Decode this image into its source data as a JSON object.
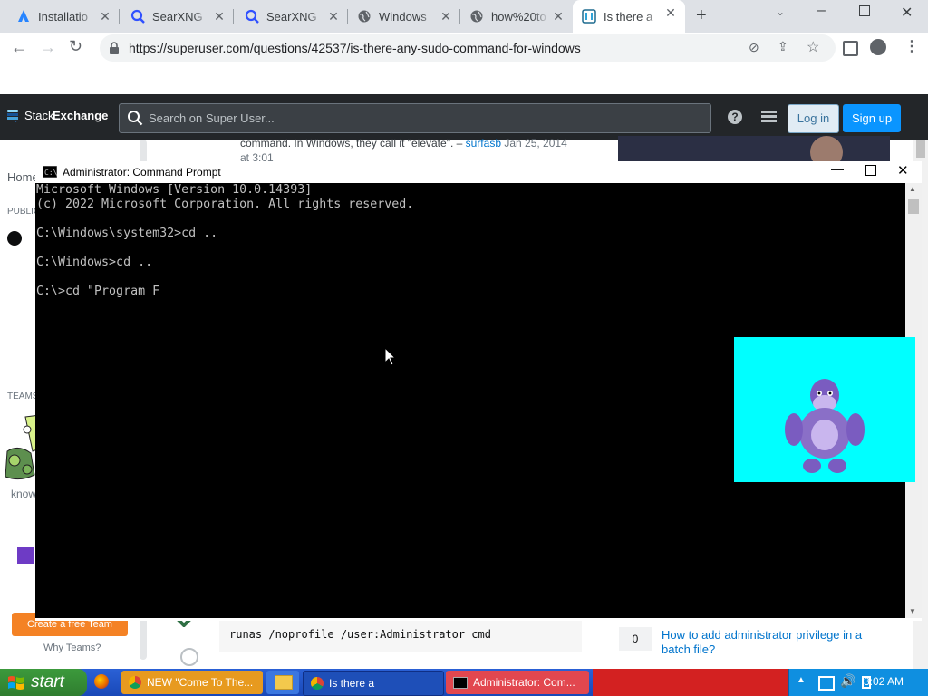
{
  "browser": {
    "tabs": [
      {
        "label": "Installatio",
        "icon": "atlassian-icon"
      },
      {
        "label": "SearXNG",
        "icon": "search-icon"
      },
      {
        "label": "SearXNG",
        "icon": "search-icon"
      },
      {
        "label": "Windows",
        "icon": "globe-icon"
      },
      {
        "label": "how%20to",
        "icon": "globe-icon"
      },
      {
        "label": "Is there a",
        "icon": "superuser-icon"
      }
    ],
    "url": "https://superuser.com/questions/42537/is-there-any-sudo-command-for-windows"
  },
  "stackexchange": {
    "logo_stack": "Stack",
    "logo_exchange": "Exchange",
    "search_placeholder": "Search on Super User...",
    "login": "Log in",
    "signup": "Sign up"
  },
  "sidebar": {
    "home": "Home",
    "public": "PUBLIC",
    "teams": "TEAMS",
    "create_team": "Create a free Team",
    "why_teams": "Why Teams?",
    "know": "know"
  },
  "page": {
    "comment": "command. In Windows, they call it \"elevate\". –",
    "comment_author": "surfasb",
    "comment_date": "Jan 25, 2014",
    "comment_time": "at 3:01",
    "code_line": "runas /noprofile /user:Administrator cmd",
    "related_count": "0",
    "related_link": "How to add administrator privilege in a batch file?"
  },
  "cmd": {
    "title": "Administrator: Command Prompt",
    "lines": [
      "Microsoft Windows [Version 10.0.14393]",
      "(c) 2022 Microsoft Corporation. All rights reserved.",
      "",
      "C:\\Windows\\system32>cd ..",
      "",
      "C:\\Windows>cd ..",
      "",
      "C:\\>cd \"Program F"
    ]
  },
  "taskbar": {
    "start": "start",
    "items": [
      {
        "label": "NEW \"Come To The..."
      },
      {
        "label": ""
      },
      {
        "label": "Is there a"
      },
      {
        "label": "Administrator: Com..."
      }
    ],
    "clock": "3:02 AM"
  },
  "colors": {
    "se_dark": "#232629",
    "se_blue": "#0a95ff",
    "taskbar_blue": "#245edb",
    "start_green": "#3c9a3c",
    "cyan_box": "#00ffff",
    "bonzi_purple": "#8a6fc7"
  }
}
